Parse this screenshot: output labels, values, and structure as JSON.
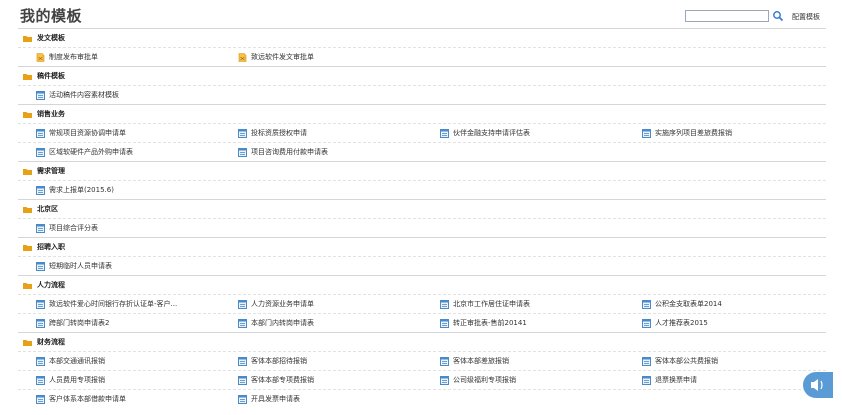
{
  "header": {
    "title": "我的模板",
    "search_placeholder": "",
    "config_label": "配置模板"
  },
  "sections": [
    {
      "title": "发文模板",
      "rows": [
        [
          {
            "label": "制度发布审批单",
            "icon": "doc-yellow-icon"
          },
          {
            "label": "致远软件发文审批单",
            "icon": "doc-yellow-icon"
          }
        ]
      ]
    },
    {
      "title": "稿件模板",
      "rows": [
        [
          {
            "label": "活动稿件内容素材模板",
            "icon": "form-icon"
          }
        ]
      ]
    },
    {
      "title": "销售业务",
      "rows": [
        [
          {
            "label": "常规项目资源协调申请单",
            "icon": "form-icon"
          },
          {
            "label": "投标资质授权申请",
            "icon": "form-icon"
          },
          {
            "label": "伙伴金融支持申请评估表",
            "icon": "form-icon"
          },
          {
            "label": "实施序列项目差旅费报销",
            "icon": "form-icon"
          }
        ],
        [
          {
            "label": "区域软硬件产品外购申请表",
            "icon": "form-icon"
          },
          {
            "label": "项目咨询费用付款申请表",
            "icon": "form-icon"
          }
        ]
      ]
    },
    {
      "title": "需求管理",
      "rows": [
        [
          {
            "label": "需求上报单(2015.6)",
            "icon": "form-icon"
          }
        ]
      ]
    },
    {
      "title": "北京区",
      "rows": [
        [
          {
            "label": "项目综合评分表",
            "icon": "form-icon"
          }
        ]
      ]
    },
    {
      "title": "招聘入职",
      "rows": [
        [
          {
            "label": "短期临时人员申请表",
            "icon": "form-icon"
          }
        ]
      ]
    },
    {
      "title": "人力流程",
      "rows": [
        [
          {
            "label": "致远软件爱心时间银行存折认证单-客户...",
            "icon": "form-icon"
          },
          {
            "label": "人力资源业务申请单",
            "icon": "form-icon"
          },
          {
            "label": "北京市工作居住证申请表",
            "icon": "form-icon"
          },
          {
            "label": "公积金支取表单2014",
            "icon": "form-icon"
          }
        ],
        [
          {
            "label": "跨部门转岗申请表2",
            "icon": "form-icon"
          },
          {
            "label": "本部门内转岗申请表",
            "icon": "form-icon"
          },
          {
            "label": "转正审批表-售前20141",
            "icon": "form-icon"
          },
          {
            "label": "人才推荐表2015",
            "icon": "form-icon"
          }
        ]
      ]
    },
    {
      "title": "财务流程",
      "rows": [
        [
          {
            "label": "本部交通通讯报销",
            "icon": "form-icon"
          },
          {
            "label": "客体本部招待报销",
            "icon": "form-icon"
          },
          {
            "label": "客体本部差旅报销",
            "icon": "form-icon"
          },
          {
            "label": "客体本部公共费报销",
            "icon": "form-icon"
          }
        ],
        [
          {
            "label": "人员费用专项报销",
            "icon": "form-icon"
          },
          {
            "label": "客体本部专项费报销",
            "icon": "form-icon"
          },
          {
            "label": "公司级福利专项报销",
            "icon": "form-icon"
          },
          {
            "label": "退票换票申请",
            "icon": "form-icon"
          }
        ],
        [
          {
            "label": "客户体系本部借款申请单",
            "icon": "form-icon"
          },
          {
            "label": "开具发票申请表",
            "icon": "form-icon"
          }
        ]
      ]
    }
  ],
  "colors": {
    "folder": "#e8a117",
    "form_icon": "#4a8ac9",
    "doc_icon": "#e0a020",
    "search": "#3a7bd5"
  }
}
